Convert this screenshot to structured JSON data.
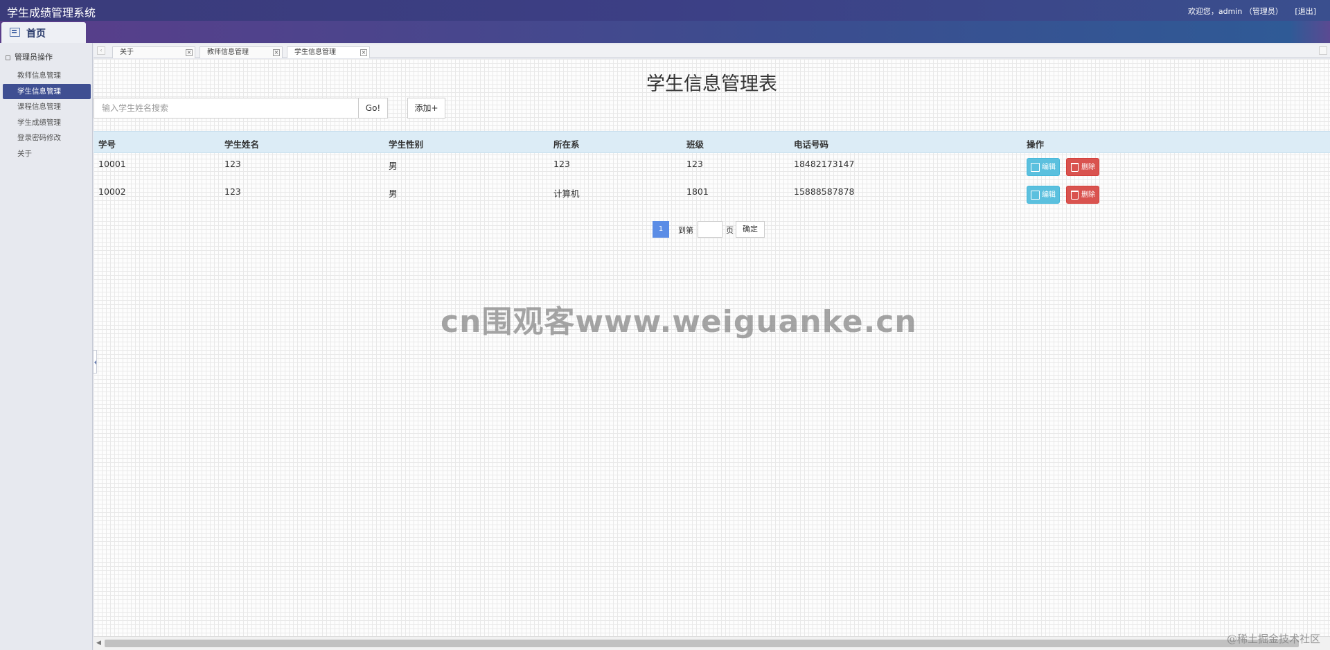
{
  "app": {
    "title": "学生成绩管理系统",
    "welcome": "欢迎您，admin （管理员）",
    "logout": "[退出]",
    "home_tab": "首页"
  },
  "sidebar": {
    "group_title": "管理员操作",
    "items": [
      {
        "label": "教师信息管理"
      },
      {
        "label": "学生信息管理"
      },
      {
        "label": "课程信息管理"
      },
      {
        "label": "学生成绩管理"
      },
      {
        "label": "登录密码修改"
      },
      {
        "label": "关于"
      }
    ],
    "active_index": 1
  },
  "tabs": [
    {
      "label": "关于"
    },
    {
      "label": "教师信息管理"
    },
    {
      "label": "学生信息管理"
    }
  ],
  "main": {
    "title": "学生信息管理表",
    "search_placeholder": "输入学生姓名搜索",
    "go_label": "Go!",
    "add_label": "添加+"
  },
  "table": {
    "headers": [
      "学号",
      "学生姓名",
      "学生性别",
      "所在系",
      "班级",
      "电话号码",
      "操作"
    ],
    "rows": [
      [
        "10001",
        "123",
        "男",
        "123",
        "123",
        "18482173147"
      ],
      [
        "10002",
        "123",
        "男",
        "计算机",
        "1801",
        "15888587878"
      ]
    ],
    "edit_label": "编辑",
    "delete_label": "删除"
  },
  "pager": {
    "current_page": "1",
    "goto_prefix": "到第",
    "goto_suffix": "页",
    "confirm_label": "确定"
  },
  "watermarks": {
    "center": "cn围观客www.weiguanke.cn",
    "corner": "@稀土掘金技术社区"
  }
}
